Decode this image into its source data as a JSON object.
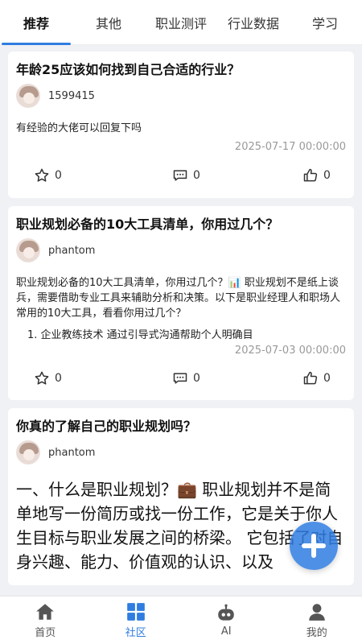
{
  "tabs": [
    {
      "label": "推荐",
      "active": true
    },
    {
      "label": "其他",
      "active": false
    },
    {
      "label": "职业测评",
      "active": false
    },
    {
      "label": "行业数据",
      "active": false
    },
    {
      "label": "学习",
      "active": false
    }
  ],
  "posts": [
    {
      "title": "年龄25应该如何找到自己合适的行业？",
      "author": "1599415",
      "body": "有经验的大佬可以回复下吗",
      "date": "2025-07-17 00:00:00",
      "stars": "0",
      "comments": "0",
      "likes": "0"
    },
    {
      "title": "职业规划必备的10大工具清单，你用过几个？",
      "author": "phantom",
      "body": "职业规划必备的10大工具清单，你用过几个？📊 职业规划不是纸上谈兵，需要借助专业工具来辅助分析和决策。以下是职业经理人和职场人常用的10大工具，看看你用过几个？",
      "list_item": "1. 企业教练技术 通过引导式沟通帮助个人明确目",
      "date": "2025-07-03 00:00:00",
      "stars": "0",
      "comments": "0",
      "likes": "0"
    },
    {
      "title": "你真的了解自己的职业规划吗？",
      "author": "phantom",
      "body": "一、什么是职业规划？💼 职业规划并不是简单地写一份简历或找一份工作，它是关于你人生目标与职业发展之间的桥梁。 它包括了对自身兴趣、能力、价值观的认识、以及"
    }
  ],
  "bottom_nav": [
    {
      "label": "首页",
      "icon": "home-icon",
      "active": false
    },
    {
      "label": "社区",
      "icon": "community-icon",
      "active": true
    },
    {
      "label": "AI",
      "icon": "ai-robot-icon",
      "active": false
    },
    {
      "label": "我的",
      "icon": "profile-icon",
      "active": false
    }
  ],
  "colors": {
    "accent": "#2f7de1",
    "background": "#f0f1f5"
  }
}
